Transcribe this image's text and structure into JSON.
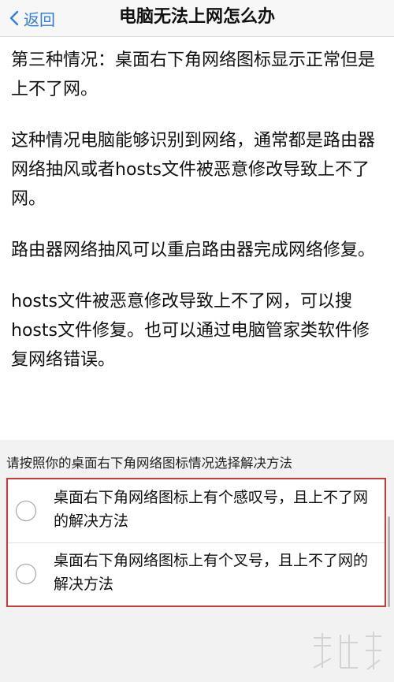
{
  "nav": {
    "back_label": "返回",
    "title": "电脑无法上网怎么办"
  },
  "article": {
    "paragraphs": [
      "第三种情况：桌面右下角网络图标显示正常但是上不了网。",
      "这种情况电脑能够识别到网络，通常都是路由器网络抽风或者hosts文件被恶意修改导致上不了网。",
      "路由器网络抽风可以重启路由器完成网络修复。",
      "hosts文件被恶意修改导致上不了网，可以搜hosts文件修复。也可以通过电脑管家类软件修复网络错误。"
    ]
  },
  "choice": {
    "prompt": "请按照你的桌面右下角网络图标情况选择解决方法",
    "options": [
      {
        "label": "桌面右下角网络图标上有个感叹号，且上不了网的解决方法"
      },
      {
        "label": "桌面右下角网络图标上有个叉号，且上不了网的解决方法"
      }
    ]
  },
  "colors": {
    "accent": "#2f7fe0",
    "highlight_border": "#c93a3a",
    "section_bg": "#f2f2f2"
  }
}
